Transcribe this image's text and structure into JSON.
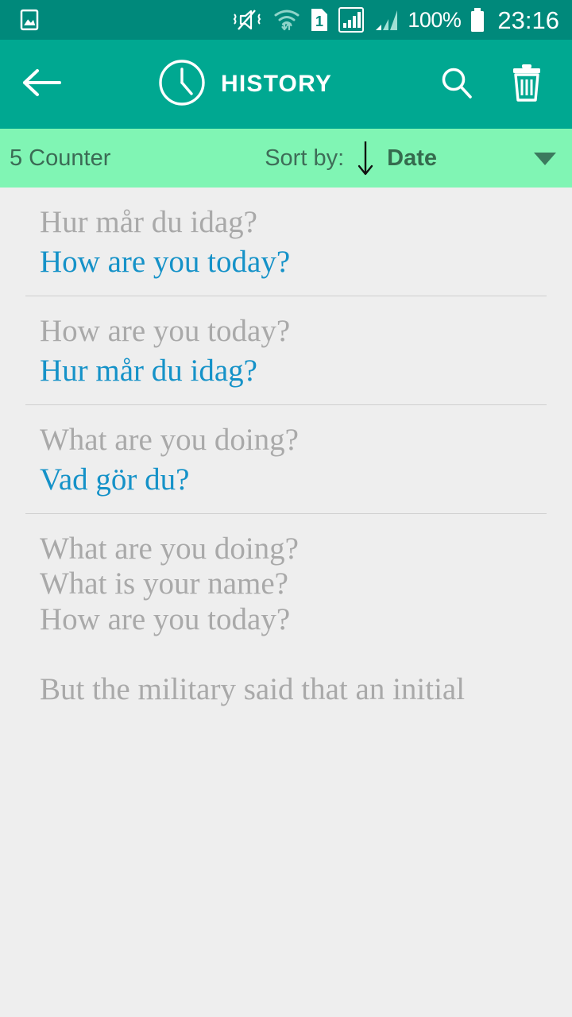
{
  "status_bar": {
    "background": "#00897b",
    "left_icons": [
      {
        "name": "picture-image-icon"
      }
    ],
    "right_icons": [
      {
        "name": "vibrate-mute-icon"
      },
      {
        "name": "wifi-transfer-icon"
      },
      {
        "name": "sim-card-1-icon"
      },
      {
        "name": "signal-strength-1-icon"
      },
      {
        "name": "signal-strength-2-icon"
      }
    ],
    "battery_percent": "100%",
    "battery_icon": "battery-full-icon",
    "time": "23:16"
  },
  "app_bar": {
    "background": "#00a891",
    "back_icon": "back-arrow-icon",
    "title_icon": "clock-icon",
    "title": "HISTORY",
    "search_icon": "search-icon",
    "delete_icon": "trash-icon"
  },
  "sort_bar": {
    "background": "#80f5b4",
    "counter": "5 Counter",
    "sort_label": "Sort by:",
    "sort_direction_icon": "arrow-down-icon",
    "sort_value": "Date",
    "dropdown_icon": "chevron-down-icon",
    "text_color": "#3b6b55"
  },
  "list": {
    "source_color": "#a9a9a9",
    "target_color": "#1592c8",
    "items": [
      {
        "source_lines": [
          "Hur mår du idag?"
        ],
        "target_lines": [
          "How are you today?"
        ],
        "divider": true
      },
      {
        "source_lines": [
          "How are you today?"
        ],
        "target_lines": [
          "Hur mår du idag?"
        ],
        "divider": true
      },
      {
        "source_lines": [
          "What are you doing?"
        ],
        "target_lines": [
          "Vad gör du?"
        ],
        "divider": true
      },
      {
        "source_lines": [
          "What are you doing?",
          "What is your name?",
          "How are you today?"
        ],
        "target_lines": [],
        "divider": false
      },
      {
        "source_lines": [
          "But the military said that an initial"
        ],
        "target_lines": [],
        "divider": false
      }
    ]
  }
}
